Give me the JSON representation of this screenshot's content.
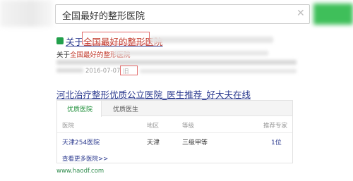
{
  "search": {
    "query": "全国最好的整形医院",
    "clear_icon": "close-icon"
  },
  "result1": {
    "title_prefix": "关于",
    "title_highlight": "全国最好的整形医院",
    "snippet_prefix": "关于",
    "snippet_highlight": "全国最好的整形医院",
    "date": "2016-07-07",
    "tag": "旧"
  },
  "result2": {
    "title": "河北治疗整形优质公立医院_医生推荐_好大夫在线",
    "tabs": [
      "优质医院",
      "优质医生"
    ],
    "table": {
      "headers": [
        "医院",
        "地区",
        "等级",
        "推荐专家"
      ],
      "rows": [
        [
          "天津254医院",
          "天津",
          "三级甲等",
          "1位"
        ]
      ]
    },
    "more_link": "查看更多医院>>",
    "url": "www.haodf.com"
  },
  "colors": {
    "link": "#2b3a8f",
    "accent_green": "#1f8f3a",
    "highlight_red": "#e26a6a"
  }
}
